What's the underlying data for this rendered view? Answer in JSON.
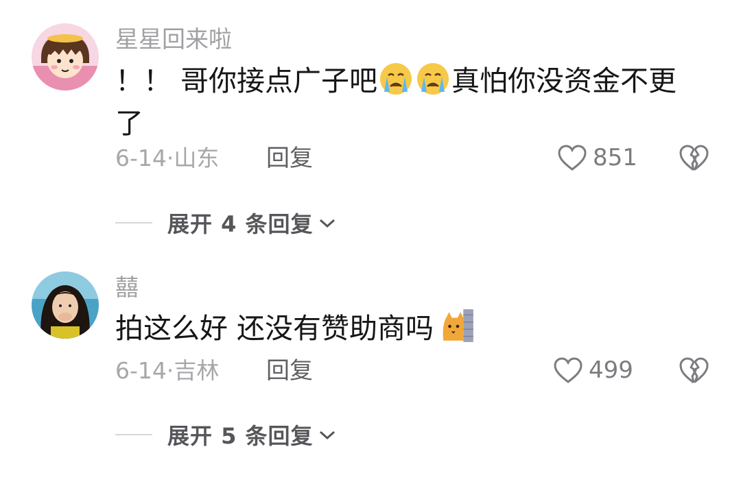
{
  "comments": [
    {
      "username": "星星回来啦",
      "text_part1": "！！ 哥你接点广子吧",
      "emojis_middle": [
        "crying-face-icon",
        "crying-face-icon"
      ],
      "text_part2": "真怕你没资金不更了",
      "date": "6-14",
      "location": "山东",
      "reply_label": "回复",
      "likes": "851",
      "expand_label": "展开 4 条回复"
    },
    {
      "username": "囍",
      "text_part1": "拍这么好 还没有赞助商吗",
      "emoji_end": "peeking-cat-icon",
      "date": "6-14",
      "location": "吉林",
      "reply_label": "回复",
      "likes": "499",
      "expand_label": "展开 5 条回复"
    }
  ],
  "colors": {
    "username": "#a0a0a4",
    "text": "#161618",
    "meta": "#a7a7ab",
    "icon": "#7b7b80"
  }
}
